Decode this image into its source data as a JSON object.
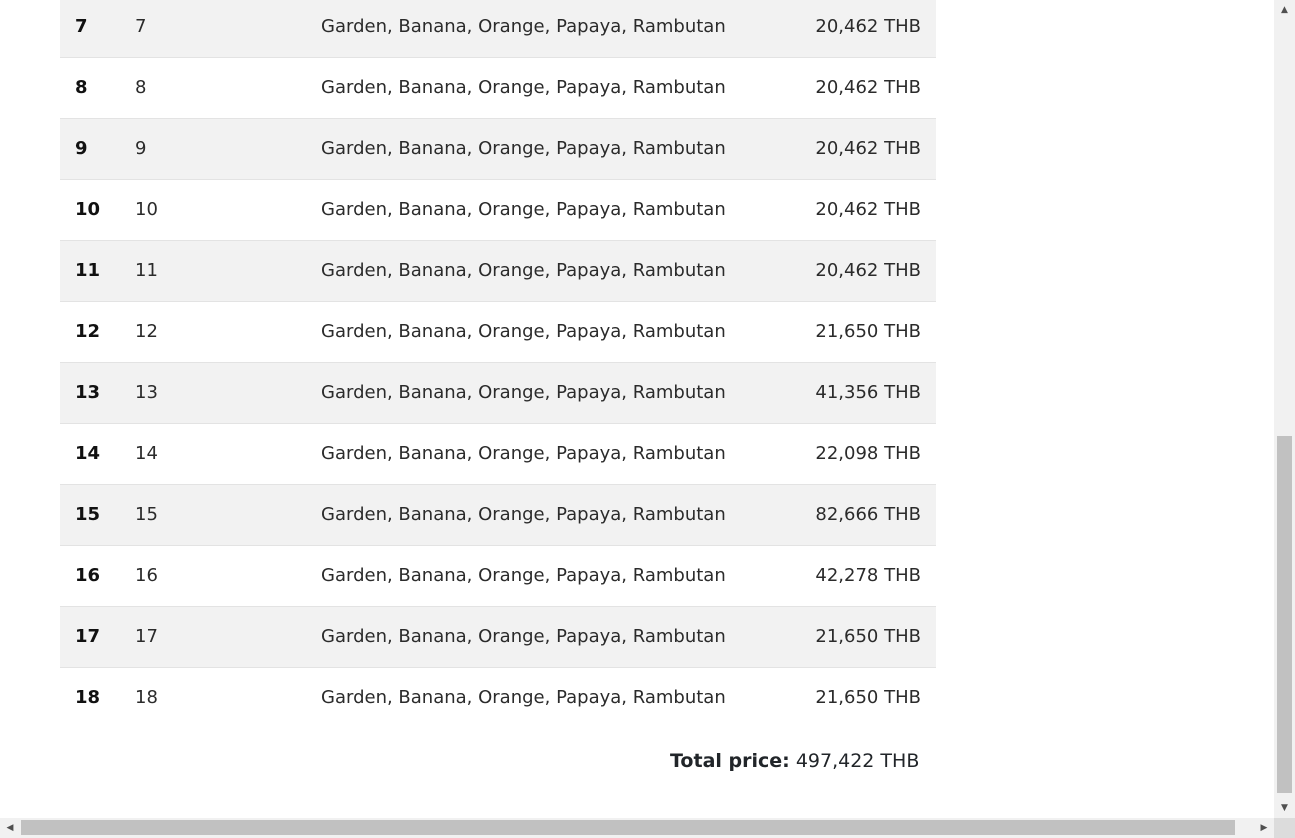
{
  "rows": [
    {
      "index": "7",
      "number": "7",
      "fruits": "Garden, Banana, Orange, Papaya, Rambutan",
      "price": "20,462 THB"
    },
    {
      "index": "8",
      "number": "8",
      "fruits": "Garden, Banana, Orange, Papaya, Rambutan",
      "price": "20,462 THB"
    },
    {
      "index": "9",
      "number": "9",
      "fruits": "Garden, Banana, Orange, Papaya, Rambutan",
      "price": "20,462 THB"
    },
    {
      "index": "10",
      "number": "10",
      "fruits": "Garden, Banana, Orange, Papaya, Rambutan",
      "price": "20,462 THB"
    },
    {
      "index": "11",
      "number": "11",
      "fruits": "Garden, Banana, Orange, Papaya, Rambutan",
      "price": "20,462 THB"
    },
    {
      "index": "12",
      "number": "12",
      "fruits": "Garden, Banana, Orange, Papaya, Rambutan",
      "price": "21,650 THB"
    },
    {
      "index": "13",
      "number": "13",
      "fruits": "Garden, Banana, Orange, Papaya, Rambutan",
      "price": "41,356 THB"
    },
    {
      "index": "14",
      "number": "14",
      "fruits": "Garden, Banana, Orange, Papaya, Rambutan",
      "price": "22,098 THB"
    },
    {
      "index": "15",
      "number": "15",
      "fruits": "Garden, Banana, Orange, Papaya, Rambutan",
      "price": "82,666 THB"
    },
    {
      "index": "16",
      "number": "16",
      "fruits": "Garden, Banana, Orange, Papaya, Rambutan",
      "price": "42,278 THB"
    },
    {
      "index": "17",
      "number": "17",
      "fruits": "Garden, Banana, Orange, Papaya, Rambutan",
      "price": "21,650 THB"
    },
    {
      "index": "18",
      "number": "18",
      "fruits": "Garden, Banana, Orange, Papaya, Rambutan",
      "price": "21,650 THB"
    }
  ],
  "total": {
    "label": "Total price:",
    "value": "497,422 THB"
  },
  "scrollbar": {
    "up_icon": "triangle-up-icon",
    "down_icon": "triangle-down-icon",
    "left_icon": "triangle-left-icon",
    "right_icon": "triangle-right-icon"
  },
  "colors": {
    "stripe": "#f2f2f2",
    "text": "#212529",
    "scroll_track": "#f1f1f1",
    "scroll_thumb": "#c1c1c1"
  }
}
